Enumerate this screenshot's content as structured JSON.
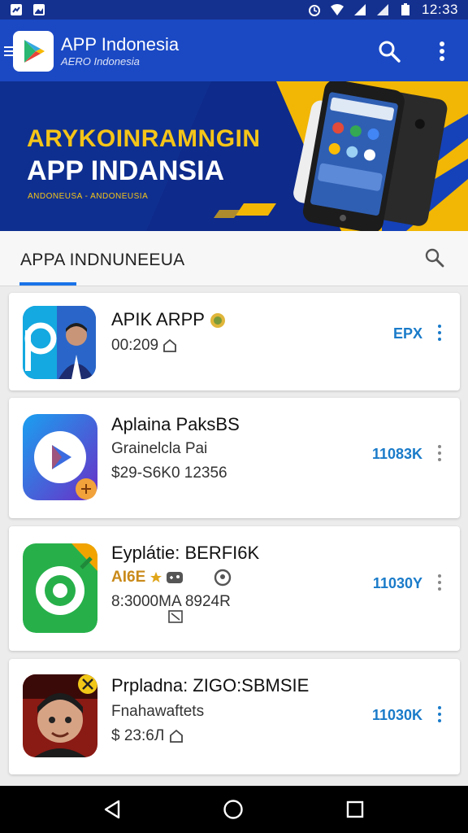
{
  "status_bar": {
    "time": "12:33",
    "icons": [
      "notification-icon",
      "image-icon",
      "alarm-icon",
      "wifi-icon",
      "signal-icon",
      "signal-icon",
      "battery-icon"
    ]
  },
  "app_bar": {
    "title": "APP Indonesia",
    "subtitle": "AERO Indonesia",
    "icons": [
      "menu-icon",
      "play-store-logo",
      "search-icon",
      "more-vert-icon"
    ],
    "colors": {
      "background": "#1b49c4",
      "status_bar": "#15318f"
    }
  },
  "banner": {
    "line1": "ARYKOINRAMNGIN",
    "line2": "APP INDANSIA",
    "line3": "ANDONEUSA - ANDONEUSIA",
    "colors": {
      "background": "#0e2a8a",
      "accent": "#f5c518"
    }
  },
  "section": {
    "title": "APPA INDNUNEEUA",
    "icons": [
      "search-icon"
    ],
    "accent": "#1a73e8"
  },
  "apps": [
    {
      "name": "APIK ARPP",
      "line1": "00:209",
      "line2": "",
      "size": "EPX",
      "icons": [
        "verified-badge-icon",
        "lock-icon"
      ]
    },
    {
      "name": "Aplaina PaksBS",
      "line1": "Grainelcla Pai",
      "line2": "$29-S6K0 12356",
      "size": "11083K",
      "icons": [
        "play-icon"
      ]
    },
    {
      "name": "Eyplátie: BERFI6K",
      "line1": "AI6E",
      "line2": "8:3000MA 8924R",
      "size": "11030Y",
      "icons": [
        "star-icon",
        "gamepad-icon",
        "location-icon",
        "expand-icon"
      ]
    },
    {
      "name": "Prpladna: ZIGO:SBMSIE",
      "line1": "Fnahawaftets",
      "line2": "$ 23:6Л",
      "size": "11030K",
      "icons": [
        "lock-icon"
      ]
    }
  ],
  "nav_bar": {
    "icons": [
      "back-icon",
      "home-icon",
      "recents-icon"
    ]
  }
}
